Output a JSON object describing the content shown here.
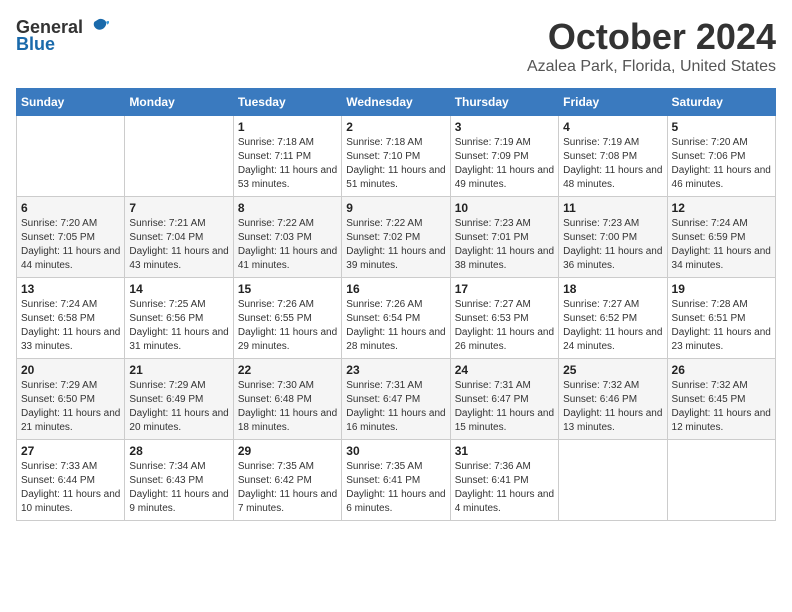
{
  "logo": {
    "general": "General",
    "blue": "Blue"
  },
  "title": "October 2024",
  "location": "Azalea Park, Florida, United States",
  "days_of_week": [
    "Sunday",
    "Monday",
    "Tuesday",
    "Wednesday",
    "Thursday",
    "Friday",
    "Saturday"
  ],
  "weeks": [
    [
      {
        "day": "",
        "info": ""
      },
      {
        "day": "",
        "info": ""
      },
      {
        "day": "1",
        "info": "Sunrise: 7:18 AM\nSunset: 7:11 PM\nDaylight: 11 hours and 53 minutes."
      },
      {
        "day": "2",
        "info": "Sunrise: 7:18 AM\nSunset: 7:10 PM\nDaylight: 11 hours and 51 minutes."
      },
      {
        "day": "3",
        "info": "Sunrise: 7:19 AM\nSunset: 7:09 PM\nDaylight: 11 hours and 49 minutes."
      },
      {
        "day": "4",
        "info": "Sunrise: 7:19 AM\nSunset: 7:08 PM\nDaylight: 11 hours and 48 minutes."
      },
      {
        "day": "5",
        "info": "Sunrise: 7:20 AM\nSunset: 7:06 PM\nDaylight: 11 hours and 46 minutes."
      }
    ],
    [
      {
        "day": "6",
        "info": "Sunrise: 7:20 AM\nSunset: 7:05 PM\nDaylight: 11 hours and 44 minutes."
      },
      {
        "day": "7",
        "info": "Sunrise: 7:21 AM\nSunset: 7:04 PM\nDaylight: 11 hours and 43 minutes."
      },
      {
        "day": "8",
        "info": "Sunrise: 7:22 AM\nSunset: 7:03 PM\nDaylight: 11 hours and 41 minutes."
      },
      {
        "day": "9",
        "info": "Sunrise: 7:22 AM\nSunset: 7:02 PM\nDaylight: 11 hours and 39 minutes."
      },
      {
        "day": "10",
        "info": "Sunrise: 7:23 AM\nSunset: 7:01 PM\nDaylight: 11 hours and 38 minutes."
      },
      {
        "day": "11",
        "info": "Sunrise: 7:23 AM\nSunset: 7:00 PM\nDaylight: 11 hours and 36 minutes."
      },
      {
        "day": "12",
        "info": "Sunrise: 7:24 AM\nSunset: 6:59 PM\nDaylight: 11 hours and 34 minutes."
      }
    ],
    [
      {
        "day": "13",
        "info": "Sunrise: 7:24 AM\nSunset: 6:58 PM\nDaylight: 11 hours and 33 minutes."
      },
      {
        "day": "14",
        "info": "Sunrise: 7:25 AM\nSunset: 6:56 PM\nDaylight: 11 hours and 31 minutes."
      },
      {
        "day": "15",
        "info": "Sunrise: 7:26 AM\nSunset: 6:55 PM\nDaylight: 11 hours and 29 minutes."
      },
      {
        "day": "16",
        "info": "Sunrise: 7:26 AM\nSunset: 6:54 PM\nDaylight: 11 hours and 28 minutes."
      },
      {
        "day": "17",
        "info": "Sunrise: 7:27 AM\nSunset: 6:53 PM\nDaylight: 11 hours and 26 minutes."
      },
      {
        "day": "18",
        "info": "Sunrise: 7:27 AM\nSunset: 6:52 PM\nDaylight: 11 hours and 24 minutes."
      },
      {
        "day": "19",
        "info": "Sunrise: 7:28 AM\nSunset: 6:51 PM\nDaylight: 11 hours and 23 minutes."
      }
    ],
    [
      {
        "day": "20",
        "info": "Sunrise: 7:29 AM\nSunset: 6:50 PM\nDaylight: 11 hours and 21 minutes."
      },
      {
        "day": "21",
        "info": "Sunrise: 7:29 AM\nSunset: 6:49 PM\nDaylight: 11 hours and 20 minutes."
      },
      {
        "day": "22",
        "info": "Sunrise: 7:30 AM\nSunset: 6:48 PM\nDaylight: 11 hours and 18 minutes."
      },
      {
        "day": "23",
        "info": "Sunrise: 7:31 AM\nSunset: 6:47 PM\nDaylight: 11 hours and 16 minutes."
      },
      {
        "day": "24",
        "info": "Sunrise: 7:31 AM\nSunset: 6:47 PM\nDaylight: 11 hours and 15 minutes."
      },
      {
        "day": "25",
        "info": "Sunrise: 7:32 AM\nSunset: 6:46 PM\nDaylight: 11 hours and 13 minutes."
      },
      {
        "day": "26",
        "info": "Sunrise: 7:32 AM\nSunset: 6:45 PM\nDaylight: 11 hours and 12 minutes."
      }
    ],
    [
      {
        "day": "27",
        "info": "Sunrise: 7:33 AM\nSunset: 6:44 PM\nDaylight: 11 hours and 10 minutes."
      },
      {
        "day": "28",
        "info": "Sunrise: 7:34 AM\nSunset: 6:43 PM\nDaylight: 11 hours and 9 minutes."
      },
      {
        "day": "29",
        "info": "Sunrise: 7:35 AM\nSunset: 6:42 PM\nDaylight: 11 hours and 7 minutes."
      },
      {
        "day": "30",
        "info": "Sunrise: 7:35 AM\nSunset: 6:41 PM\nDaylight: 11 hours and 6 minutes."
      },
      {
        "day": "31",
        "info": "Sunrise: 7:36 AM\nSunset: 6:41 PM\nDaylight: 11 hours and 4 minutes."
      },
      {
        "day": "",
        "info": ""
      },
      {
        "day": "",
        "info": ""
      }
    ]
  ]
}
